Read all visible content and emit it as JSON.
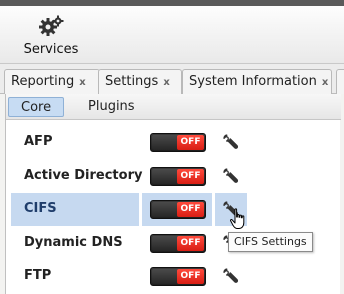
{
  "toolbar": {
    "services_label": "Services",
    "services_icon": "gears-icon"
  },
  "tabs": [
    {
      "label": "Reporting",
      "close": "x"
    },
    {
      "label": "Settings",
      "close": "x"
    },
    {
      "label": "System Information",
      "close": "x"
    }
  ],
  "subtabs": {
    "core": "Core",
    "plugins": "Plugins",
    "active": "Core"
  },
  "services": [
    {
      "name": "AFP",
      "state": "OFF",
      "selected": false
    },
    {
      "name": "Active Directory",
      "state": "OFF",
      "selected": false
    },
    {
      "name": "CIFS",
      "state": "OFF",
      "selected": true
    },
    {
      "name": "Dynamic DNS",
      "state": "OFF",
      "selected": false
    },
    {
      "name": "FTP",
      "state": "OFF",
      "selected": false
    }
  ],
  "tooltip": "CIFS Settings",
  "colors": {
    "selection": "#c6d9f0",
    "toggle_off": "#e8271b",
    "active_subtab": "#c7dcf3"
  }
}
